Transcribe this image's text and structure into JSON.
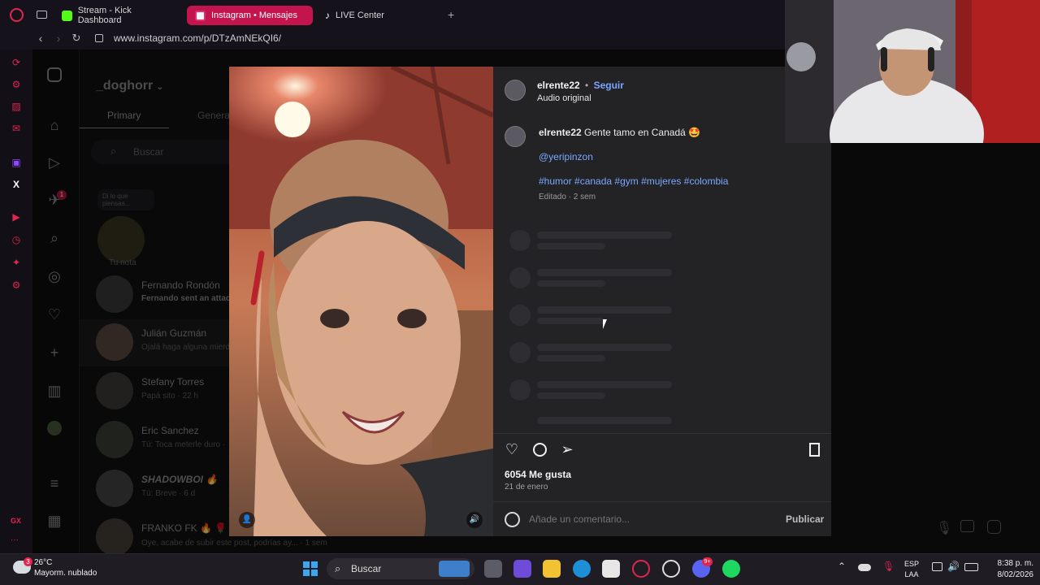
{
  "browser": {
    "tabs": [
      {
        "label": "Stream - Kick Dashboard",
        "icon": "kick-icon",
        "color": "#53fc18"
      },
      {
        "label": "Instagram • Mensajes",
        "icon": "instagram-icon",
        "color": "#e1306c",
        "active": true
      },
      {
        "label": "LIVE Center",
        "icon": "tiktok-icon",
        "color": "#ffffff"
      }
    ],
    "new_tab_label": "+",
    "url": "www.instagram.com/p/DTzAmNEkQI6/"
  },
  "opera_sidebar": {
    "gx_label": "GX",
    "more_label": "···"
  },
  "instagram": {
    "account_name": "_doghorr",
    "tabs": [
      "Primary",
      "General"
    ],
    "search_placeholder": "Buscar",
    "note": {
      "bubble": "Di lo que piensas...",
      "label": "Tu nota"
    },
    "notifications_badge": "1",
    "conversations": [
      {
        "name": "Fernando Rondón",
        "preview": "Fernando sent an attach"
      },
      {
        "name": "Julián Guzmán",
        "preview": "Ojalá haga alguna mierd"
      },
      {
        "name": "Stefany Torres",
        "preview": "Papá sito · 22 h"
      },
      {
        "name": "Eric Sanchez",
        "preview": "Tú: Toca meterle duro ·"
      },
      {
        "name": "SHADOWBOI 🔥",
        "preview": "Tú: Breve · 6 d"
      },
      {
        "name": "FRANKO FK 🔥 🌹",
        "preview": "Oye, acabe de subir este post, podrías ay... · 1 sem"
      }
    ]
  },
  "post": {
    "author": "elrente22",
    "follow_label": "Seguir",
    "separator": "•",
    "audio": "Audio original",
    "caption_author": "elrente22",
    "caption_text": "Gente tamo en Canadá 🤩",
    "mention": "@yeripinzon",
    "hashtags": "#humor #canada #gym #mujeres #colombia",
    "meta": "Editado · 2 sem",
    "likes": "6054 Me gusta",
    "date": "21 de enero",
    "comment_placeholder": "Añade un comentario...",
    "publish_label": "Publicar"
  },
  "taskbar": {
    "weather_temp": "26°C",
    "weather_desc": "Mayorm. nublado",
    "weather_badge": "3",
    "search_label": "Buscar",
    "discord_badge": "9+",
    "lang_top": "ESP",
    "lang_bottom": "LAA",
    "time": "8:38 p. m.",
    "date": "8/02/2026"
  }
}
